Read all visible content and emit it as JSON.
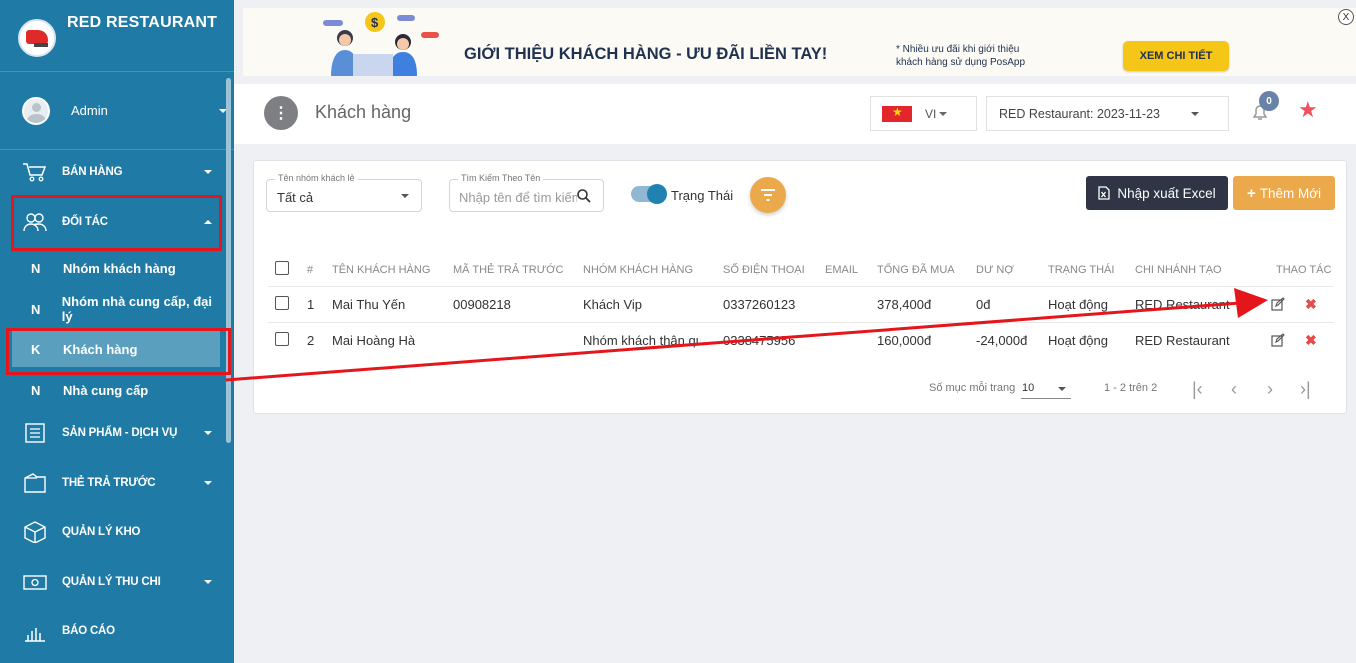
{
  "app": {
    "title": "RED RESTAURANT"
  },
  "user": {
    "name": "Admin"
  },
  "sidebar": {
    "items": [
      {
        "label": "BÁN HÀNG",
        "icon": "cart-icon"
      },
      {
        "label": "ĐỐI TÁC",
        "icon": "partners-icon"
      },
      {
        "label": "SẢN PHẨM - DỊCH VỤ",
        "icon": "products-icon"
      },
      {
        "label": "THẺ TRẢ TRƯỚC",
        "icon": "prepaid-card-icon"
      },
      {
        "label": "QUẢN LÝ KHO",
        "icon": "box-icon"
      },
      {
        "label": "QUẢN LÝ THU CHI",
        "icon": "cash-icon"
      },
      {
        "label": "BÁO CÁO",
        "icon": "report-icon"
      }
    ],
    "sub_items": [
      {
        "letter": "N",
        "label": "Nhóm khách hàng"
      },
      {
        "letter": "N",
        "label": "Nhóm nhà cung cấp, đại lý"
      },
      {
        "letter": "K",
        "label": "Khách hàng"
      },
      {
        "letter": "N",
        "label": "Nhà cung cấp"
      }
    ]
  },
  "banner": {
    "title": "GIỚI THIỆU KHÁCH HÀNG - ƯU ĐÃI LIỀN TAY!",
    "note_line1": "* Nhiều ưu đãi khi giới thiệu",
    "note_line2": "khách hàng sử dụng PosApp",
    "button": "XEM CHI TIẾT",
    "close": "X"
  },
  "header": {
    "title": "Khách hàng",
    "language": "VI",
    "branch": "RED Restaurant: 2023-11-23",
    "notification_count": "0"
  },
  "filters": {
    "group_label": "Tên nhóm khách lẻ",
    "group_value": "Tất cả",
    "search_label": "Tìm Kiếm Theo Tên",
    "search_placeholder": "Nhập tên để tìm kiếm",
    "status_label": "Trạng Thái"
  },
  "actions": {
    "excel": "Nhập xuất Excel",
    "add": "Thêm Mới"
  },
  "table": {
    "headers": [
      "#",
      "TÊN KHÁCH HÀNG",
      "MÃ THẺ TRẢ TRƯỚC",
      "NHÓM KHÁCH HÀNG",
      "SỐ ĐIỆN THOẠI",
      "EMAIL",
      "TỔNG ĐÃ MUA",
      "DƯ NỢ",
      "TRẠNG THÁI",
      "CHI NHÁNH TẠO",
      "THAO TÁC"
    ],
    "rows": [
      {
        "no": "1",
        "name": "Mai Thu Yến",
        "card": "00908218",
        "group": "Khách Vip",
        "phone": "0337260123",
        "email": "",
        "total": "378,400đ",
        "debt": "0đ",
        "status": "Hoạt động",
        "branch": "RED Restaurant"
      },
      {
        "no": "2",
        "name": "Mai Hoàng Hà",
        "card": "",
        "group": "Nhóm khách thân qu",
        "phone": "0338475956",
        "email": "",
        "total": "160,000đ",
        "debt": "-24,000đ",
        "status": "Hoạt động",
        "branch": "RED Restaurant"
      }
    ]
  },
  "pagination": {
    "per_page_label": "Số mục mỗi trang",
    "per_page": "10",
    "range": "1 - 2 trên 2"
  },
  "colors": {
    "sidebar": "#1f7aa6",
    "accent": "#eca94c",
    "highlight": "#e5161b"
  }
}
